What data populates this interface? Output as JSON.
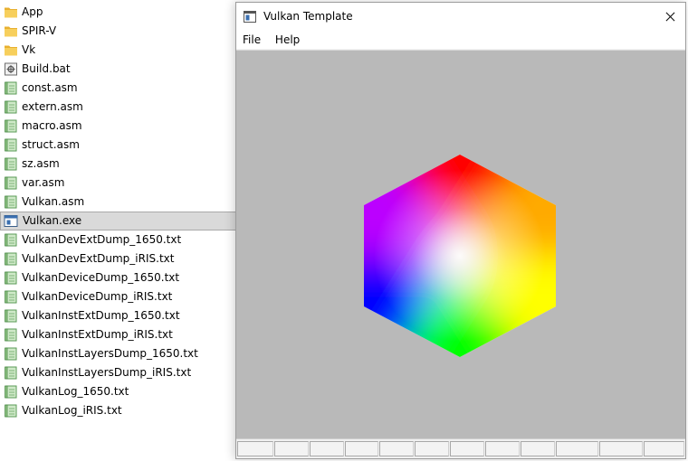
{
  "files": [
    {
      "name": "App",
      "icon": "folder-icon"
    },
    {
      "name": "SPIR-V",
      "icon": "folder-icon"
    },
    {
      "name": "Vk",
      "icon": "folder-icon"
    },
    {
      "name": "Build.bat",
      "icon": "batch-file-icon"
    },
    {
      "name": "const.asm",
      "icon": "text-file-icon"
    },
    {
      "name": "extern.asm",
      "icon": "text-file-icon"
    },
    {
      "name": "macro.asm",
      "icon": "text-file-icon"
    },
    {
      "name": "struct.asm",
      "icon": "text-file-icon"
    },
    {
      "name": "sz.asm",
      "icon": "text-file-icon"
    },
    {
      "name": "var.asm",
      "icon": "text-file-icon"
    },
    {
      "name": "Vulkan.asm",
      "icon": "text-file-icon"
    },
    {
      "name": "Vulkan.exe",
      "icon": "exe-file-icon",
      "selected": true
    },
    {
      "name": "VulkanDevExtDump_1650.txt",
      "icon": "text-file-icon"
    },
    {
      "name": "VulkanDevExtDump_iRIS.txt",
      "icon": "text-file-icon"
    },
    {
      "name": "VulkanDeviceDump_1650.txt",
      "icon": "text-file-icon"
    },
    {
      "name": "VulkanDeviceDump_iRIS.txt",
      "icon": "text-file-icon"
    },
    {
      "name": "VulkanInstExtDump_1650.txt",
      "icon": "text-file-icon"
    },
    {
      "name": "VulkanInstExtDump_iRIS.txt",
      "icon": "text-file-icon"
    },
    {
      "name": "VulkanInstLayersDump_1650.txt",
      "icon": "text-file-icon"
    },
    {
      "name": "VulkanInstLayersDump_iRIS.txt",
      "icon": "text-file-icon"
    },
    {
      "name": "VulkanLog_1650.txt",
      "icon": "text-file-icon"
    },
    {
      "name": "VulkanLog_iRIS.txt",
      "icon": "text-file-icon"
    }
  ],
  "window": {
    "title": "Vulkan Template",
    "close_glyph": "✕",
    "menu": [
      "File",
      "Help"
    ],
    "viewport_background": "#b9b9b9",
    "status_cell_count": 12
  },
  "colors": {
    "folder": "#f2c14e",
    "selection": "#d9d9d9",
    "hex_top": "#ff0000",
    "hex_upper_right": "#ffaa00",
    "hex_lower_right": "#ffff00",
    "hex_bottom": "#00ff00",
    "hex_lower_left": "#0000ff",
    "hex_upper_left": "#bb00ff",
    "hex_center": "#ffffff"
  }
}
